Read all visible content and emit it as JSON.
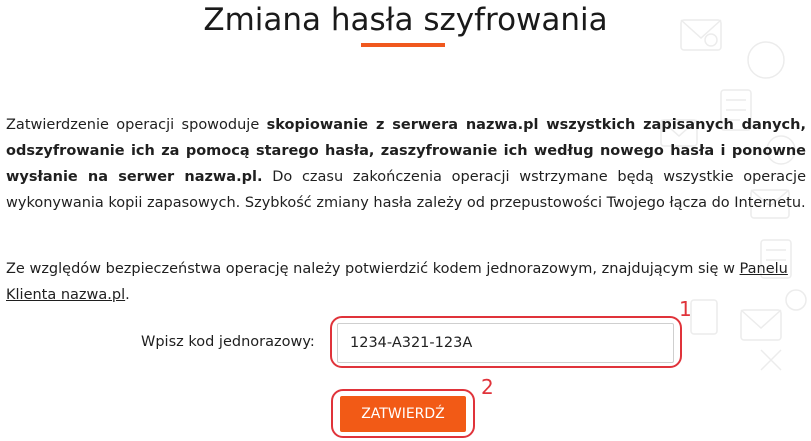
{
  "page": {
    "title": "Zmiana hasła szyfrowania"
  },
  "intro": {
    "t1": "Zatwierdzenie operacji spowoduje ",
    "b1": "skopiowanie z serwera nazwa.pl wszystkich zapisanych danych, odszyfrowanie ich za pomocą starego hasła, zaszyfrowanie ich według nowego hasła i ponowne wysłanie na serwer nazwa.pl.",
    "t2": " Do czasu zakończenia operacji wstrzymane będą wszystkie operacje wykonywania kopii zapasowych. Szybkość zmiany hasła zależy od przepustowości Twojego łącza do Internetu."
  },
  "security_note": {
    "text": "Ze względów bezpieczeństwa operację należy potwierdzić kodem jednorazowym, znajdującym się w ",
    "link_label": "Panelu Klienta nazwa.pl",
    "suffix": "."
  },
  "form": {
    "code_label": "Wpisz kod jednorazowy:",
    "code_value": "1234-A321-123A",
    "submit_label": "ZATWIERDŹ"
  },
  "annotations": {
    "marker_1": "1",
    "marker_2": "2",
    "color": "#e0333a"
  },
  "colors": {
    "accent": "#f25a16"
  }
}
